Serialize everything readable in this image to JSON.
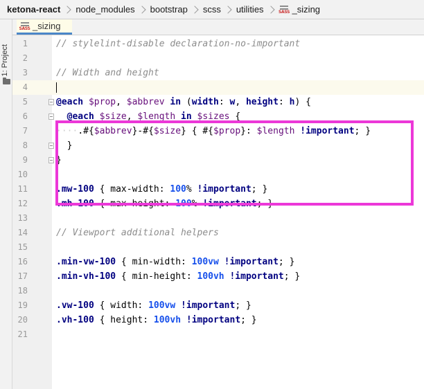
{
  "breadcrumb": {
    "project": "ketona-react",
    "items": [
      "node_modules",
      "bootstrap",
      "scss",
      "utilities"
    ],
    "file": "_sizing",
    "file_icon_text": "SASS"
  },
  "toolstrip": {
    "project_label": "1: Project"
  },
  "tab": {
    "label": "_sizing",
    "icon_text": "SASS"
  },
  "editor": {
    "current_line": 4,
    "lines": [
      {
        "n": "1",
        "tokens": [
          [
            "comment",
            "// stylelint-disable declaration-no-important"
          ]
        ]
      },
      {
        "n": "2",
        "tokens": []
      },
      {
        "n": "3",
        "tokens": [
          [
            "comment",
            "// Width and height"
          ]
        ]
      },
      {
        "n": "4",
        "tokens": []
      },
      {
        "n": "5",
        "tokens": [
          [
            "kw",
            "@each "
          ],
          [
            "var",
            "$prop"
          ],
          [
            "plain",
            ", "
          ],
          [
            "var",
            "$abbrev "
          ],
          [
            "kw",
            "in "
          ],
          [
            "plain",
            "("
          ],
          [
            "sel",
            "width"
          ],
          [
            "plain",
            ": "
          ],
          [
            "sel",
            "w"
          ],
          [
            "plain",
            ", "
          ],
          [
            "sel",
            "height"
          ],
          [
            "plain",
            ": "
          ],
          [
            "sel",
            "h"
          ],
          [
            "plain",
            ") {"
          ]
        ]
      },
      {
        "n": "6",
        "tokens": [
          [
            "plain",
            "  "
          ],
          [
            "kw",
            "@each "
          ],
          [
            "var",
            "$size"
          ],
          [
            "plain",
            ", "
          ],
          [
            "var",
            "$length "
          ],
          [
            "kw",
            "in "
          ],
          [
            "var",
            "$sizes "
          ],
          [
            "plain",
            "{"
          ]
        ]
      },
      {
        "n": "7",
        "tokens": [
          [
            "dots",
            "····"
          ],
          [
            "plain",
            "."
          ],
          [
            "plain",
            "#{"
          ],
          [
            "var",
            "$abbrev"
          ],
          [
            "plain",
            "}-#{"
          ],
          [
            "var",
            "$size"
          ],
          [
            "plain",
            "} { #{"
          ],
          [
            "var",
            "$prop"
          ],
          [
            "plain",
            "}: "
          ],
          [
            "var",
            "$length "
          ],
          [
            "imp",
            "!important"
          ],
          [
            "plain",
            "; }"
          ]
        ]
      },
      {
        "n": "8",
        "tokens": [
          [
            "plain",
            "  }"
          ]
        ]
      },
      {
        "n": "9",
        "tokens": [
          [
            "plain",
            "}"
          ]
        ]
      },
      {
        "n": "10",
        "tokens": []
      },
      {
        "n": "11",
        "tokens": [
          [
            "sel",
            ".mw-100 "
          ],
          [
            "plain",
            "{ max-width: "
          ],
          [
            "num",
            "100"
          ],
          [
            "plain",
            "% "
          ],
          [
            "imp",
            "!important"
          ],
          [
            "plain",
            "; }"
          ]
        ]
      },
      {
        "n": "12",
        "tokens": [
          [
            "sel",
            ".mh-100 "
          ],
          [
            "plain",
            "{ max-height: "
          ],
          [
            "num",
            "100"
          ],
          [
            "plain",
            "% "
          ],
          [
            "imp",
            "!important"
          ],
          [
            "plain",
            "; }"
          ]
        ]
      },
      {
        "n": "13",
        "tokens": []
      },
      {
        "n": "14",
        "tokens": [
          [
            "comment",
            "// Viewport additional helpers"
          ]
        ]
      },
      {
        "n": "15",
        "tokens": []
      },
      {
        "n": "16",
        "tokens": [
          [
            "sel",
            ".min-vw-100 "
          ],
          [
            "plain",
            "{ min-width: "
          ],
          [
            "num",
            "100vw "
          ],
          [
            "imp",
            "!important"
          ],
          [
            "plain",
            "; }"
          ]
        ]
      },
      {
        "n": "17",
        "tokens": [
          [
            "sel",
            ".min-vh-100 "
          ],
          [
            "plain",
            "{ min-height: "
          ],
          [
            "num",
            "100vh "
          ],
          [
            "imp",
            "!important"
          ],
          [
            "plain",
            "; }"
          ]
        ]
      },
      {
        "n": "18",
        "tokens": []
      },
      {
        "n": "19",
        "tokens": [
          [
            "sel",
            ".vw-100 "
          ],
          [
            "plain",
            "{ width: "
          ],
          [
            "num",
            "100vw "
          ],
          [
            "imp",
            "!important"
          ],
          [
            "plain",
            "; }"
          ]
        ]
      },
      {
        "n": "20",
        "tokens": [
          [
            "sel",
            ".vh-100 "
          ],
          [
            "plain",
            "{ height: "
          ],
          [
            "num",
            "100vh "
          ],
          [
            "imp",
            "!important"
          ],
          [
            "plain",
            "; }"
          ]
        ]
      },
      {
        "n": "21",
        "tokens": []
      }
    ]
  },
  "colors": {
    "highlight": "#ec38d8",
    "tab_underline": "#4a86c8",
    "current_line": "#fcfaed"
  }
}
